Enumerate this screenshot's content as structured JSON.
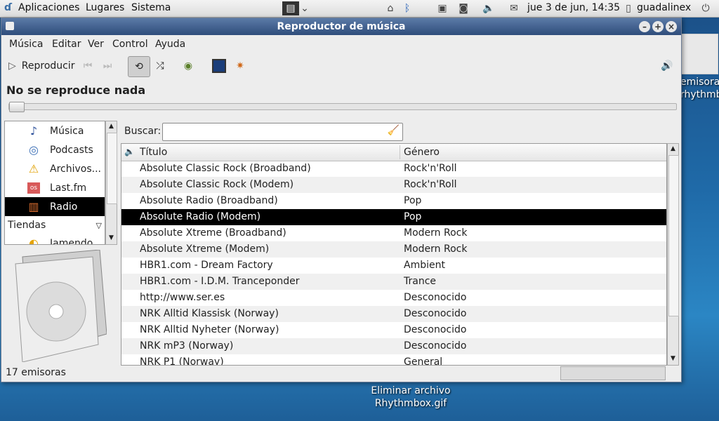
{
  "panel": {
    "menu_applications": "Aplicaciones",
    "menu_places": "Lugares",
    "menu_system": "Sistema",
    "clock": "jue  3 de jun, 14:35",
    "user": "guadalinex"
  },
  "desktop": {
    "icon_right_label": "emisoras\nrhythmbox.gif",
    "icon_bottom_label": "Eliminar archivo\nRhythmbox.gif"
  },
  "window": {
    "title": "Reproductor de música",
    "menu": [
      "Música",
      "Editar",
      "Ver",
      "Control",
      "Ayuda"
    ],
    "toolbar": {
      "play_label": "Reproducir"
    },
    "now_playing": "No se reproduce nada",
    "sources": [
      {
        "label": "Música",
        "icon": "music-note-icon"
      },
      {
        "label": "Podcasts",
        "icon": "podcast-icon"
      },
      {
        "label": "Archivos...",
        "icon": "warning-icon"
      },
      {
        "label": "Last.fm",
        "icon": "lastfm-icon"
      },
      {
        "label": "Radio",
        "icon": "radio-icon",
        "selected": true
      }
    ],
    "stores_header": "Tiendas",
    "stores": [
      {
        "label": "Jamendo",
        "icon": "jamendo-icon"
      }
    ],
    "search_label": "Buscar:",
    "search_value": "",
    "columns": [
      "Título",
      "Género"
    ],
    "stations": [
      {
        "title": "Absolute Classic Rock (Broadband)",
        "genre": "Rock'n'Roll"
      },
      {
        "title": "Absolute Classic Rock (Modem)",
        "genre": "Rock'n'Roll"
      },
      {
        "title": "Absolute Radio (Broadband)",
        "genre": "Pop"
      },
      {
        "title": "Absolute Radio (Modem)",
        "genre": "Pop",
        "selected": true
      },
      {
        "title": "Absolute Xtreme (Broadband)",
        "genre": "Modern Rock"
      },
      {
        "title": "Absolute Xtreme (Modem)",
        "genre": "Modern Rock"
      },
      {
        "title": "HBR1.com - Dream Factory",
        "genre": "Ambient"
      },
      {
        "title": "HBR1.com - I.D.M. Tranceponder",
        "genre": "Trance"
      },
      {
        "title": "http://www.ser.es",
        "genre": "Desconocido"
      },
      {
        "title": "NRK Alltid Klassisk (Norway)",
        "genre": "Desconocido"
      },
      {
        "title": "NRK Alltid Nyheter (Norway)",
        "genre": "Desconocido"
      },
      {
        "title": "NRK mP3 (Norway)",
        "genre": "Desconocido"
      },
      {
        "title": "NRK P1 (Norway)",
        "genre": "General"
      }
    ],
    "status": "17 emisoras"
  }
}
